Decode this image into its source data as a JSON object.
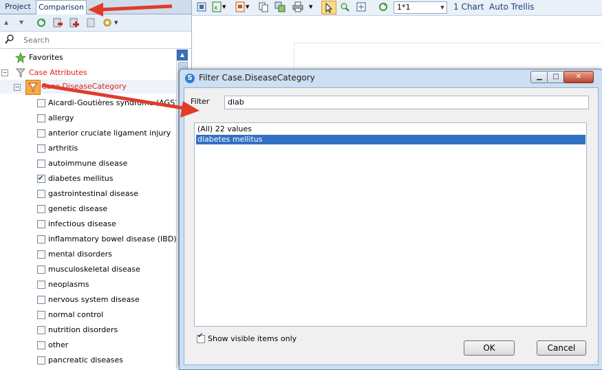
{
  "left_panel": {
    "tabs": [
      {
        "label": "Project"
      },
      {
        "label": "Comparison"
      }
    ],
    "search_placeholder": "Search",
    "tree": {
      "favorites": "Favorites",
      "case_attributes": "Case Attributes",
      "category_node": "Case.DiseaseCategory",
      "items": [
        {
          "label": "Aicardi-Goutières syndrome (AGS)",
          "checked": false
        },
        {
          "label": "allergy",
          "checked": false
        },
        {
          "label": "anterior cruciate ligament injury",
          "checked": false
        },
        {
          "label": "arthritis",
          "checked": false
        },
        {
          "label": "autoimmune disease",
          "checked": false
        },
        {
          "label": "diabetes mellitus",
          "checked": true
        },
        {
          "label": "gastrointestinal disease",
          "checked": false
        },
        {
          "label": "genetic disease",
          "checked": false
        },
        {
          "label": "infectious disease",
          "checked": false
        },
        {
          "label": "inflammatory bowel disease (IBD)",
          "checked": false
        },
        {
          "label": "mental disorders",
          "checked": false
        },
        {
          "label": "musculoskeletal disease",
          "checked": false
        },
        {
          "label": "neoplasms",
          "checked": false
        },
        {
          "label": "nervous system disease",
          "checked": false
        },
        {
          "label": "normal control",
          "checked": false
        },
        {
          "label": "nutrition disorders",
          "checked": false
        },
        {
          "label": "other",
          "checked": false
        },
        {
          "label": "pancreatic diseases",
          "checked": false
        }
      ]
    }
  },
  "right_toolbar": {
    "layout_value": "1*1",
    "chart_count_label": "1 Chart",
    "auto_trellis_label": "Auto Trellis"
  },
  "dialog": {
    "title": "Filter Case.DiseaseCategory",
    "filter_label": "Filter",
    "filter_value": "diab",
    "list_items": [
      {
        "label": "(All) 22 values",
        "selected": false
      },
      {
        "label": "diabetes mellitus",
        "selected": true
      }
    ],
    "show_visible_label": "Show visible items only",
    "show_visible_checked": true,
    "ok_label": "OK",
    "cancel_label": "Cancel"
  },
  "colors": {
    "annotation_arrow": "#e23b2a",
    "selection": "#3270c4",
    "case_attributes_text": "#e0201a"
  }
}
